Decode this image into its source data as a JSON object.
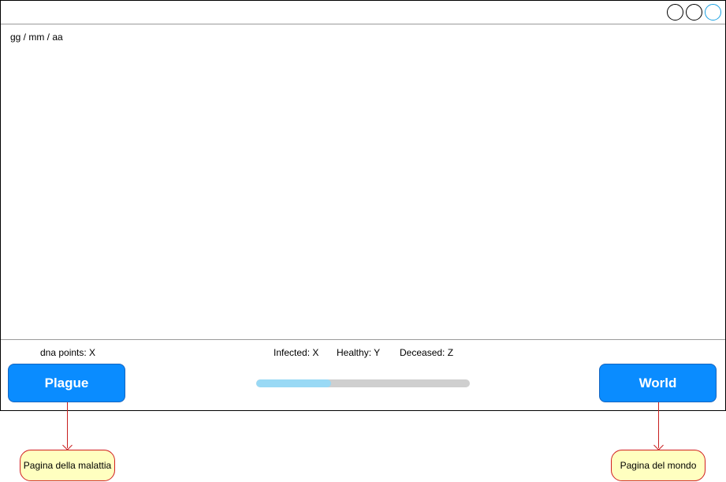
{
  "window": {
    "date_label": "gg / mm / aa",
    "controls": [
      "minimize-button",
      "maximize-button",
      "close-button"
    ]
  },
  "stats": {
    "dna_points": "dna points: X",
    "infected": "Infected: X",
    "healthy": "Healthy: Y",
    "deceased": "Deceased: Z"
  },
  "buttons": {
    "plague": "Plague",
    "world": "World"
  },
  "progress": {
    "value": 0.35,
    "fill_color": "#99d9f5",
    "track_color": "#cfcfcf"
  },
  "annotations": {
    "plague": "Pagina della malattia",
    "world": "Pagina del mondo"
  },
  "colors": {
    "button": "#0a8cff",
    "annotation_border": "#d11f1f",
    "annotation_fill": "#ffffc0"
  }
}
